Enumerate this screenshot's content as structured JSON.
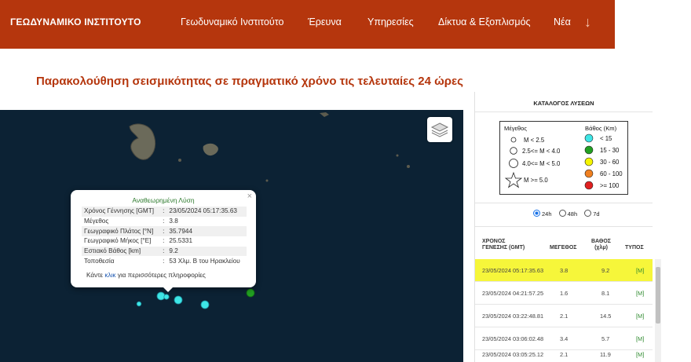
{
  "brand": "ΓΕΩΔΥΝΑΜΙΚΟ ΙΝΣΤΙΤΟΥΤΟ",
  "nav": {
    "items": [
      "Γεωδυναμικό Ινστιτούτο",
      "Έρευνα",
      "Υπηρεσίες",
      "Δίκτυα & Εξοπλισμός",
      "Νέα"
    ],
    "arrow": "↓"
  },
  "page_title": "Παρακολούθηση σεισμικότητας σε πραγματικό χρόνο τις τελευταίες 24 ώρες",
  "popup": {
    "title": "Αναθεωρημένη Λύση",
    "close": "×",
    "rows": [
      {
        "label": "Χρόνος Γέννησης [GMT]",
        "value": "23/05/2024 05:17:35.63"
      },
      {
        "label": "Μέγεθος",
        "value": "3.8"
      },
      {
        "label": "Γεωγραφικό Πλάτος [°N]",
        "value": "35.7944"
      },
      {
        "label": "Γεωγραφικό Μήκος [°E]",
        "value": "25.5331"
      },
      {
        "label": "Εστιακό Βάθος [km]",
        "value": "9.2"
      },
      {
        "label": "Τοποθεσία",
        "value": "53 Χλμ. Β του Ηρακλείου"
      }
    ],
    "more_pre": "Κάντε ",
    "more_link": "κλικ",
    "more_post": " για περισσότερες πληροφορίες"
  },
  "panel": {
    "title": "ΚΑΤΑΛΟΓΟΣ ΛΥΣΕΩΝ",
    "legend": {
      "magnitude_title": "Μέγεθος",
      "magnitude_items": [
        "M < 2.5",
        "2.5<= M < 4.0",
        "4.0<= M < 5.0",
        "M >= 5.0"
      ],
      "depth_title": "Βάθος (Km)",
      "depth_items": [
        {
          "label": "< 15",
          "color": "#3ee6e6"
        },
        {
          "label": "15 - 30",
          "color": "#22a022"
        },
        {
          "label": "30 - 60",
          "color": "#f5f500"
        },
        {
          "label": "60 - 100",
          "color": "#f08020"
        },
        {
          "label": ">= 100",
          "color": "#e02020"
        }
      ]
    },
    "periods": [
      "24h",
      "48h",
      "7d"
    ],
    "selected_period": "24h",
    "columns": {
      "time": "ΧΡΟΝΟΣ\nΓΕΝΕΣΗΣ (GMT)",
      "magnitude": "ΜΕΓΕΘΟΣ",
      "depth": "ΒΑΘΟΣ\n(χλμ)",
      "type": "ΤΥΠΟΣ"
    },
    "rows": [
      {
        "time": "23/05/2024 05:17:35.63",
        "mag": "3.8",
        "depth": "9.2",
        "type": "[M]"
      },
      {
        "time": "23/05/2024 04:21:57.25",
        "mag": "1.6",
        "depth": "8.1",
        "type": "[M]"
      },
      {
        "time": "23/05/2024 03:22:48.81",
        "mag": "2.1",
        "depth": "14.5",
        "type": "[M]"
      },
      {
        "time": "23/05/2024 03:06:02.48",
        "mag": "3.4",
        "depth": "5.7",
        "type": "[M]"
      },
      {
        "time": "23/05/2024 03:05:25.12",
        "mag": "2.1",
        "depth": "11.9",
        "type": "[M]"
      }
    ]
  },
  "map": {
    "sea_color": "#0c2234",
    "land_color": "#6b6a5a",
    "events": [
      {
        "name": "quake-marker-1",
        "size": "medium",
        "depth_class": "< 15"
      },
      {
        "name": "quake-marker-2",
        "size": "small",
        "depth_class": "< 15"
      },
      {
        "name": "quake-marker-3",
        "size": "medium",
        "depth_class": "< 15"
      },
      {
        "name": "quake-marker-4",
        "size": "medium",
        "depth_class": "< 15"
      },
      {
        "name": "quake-marker-5",
        "size": "small",
        "depth_class": "< 15"
      },
      {
        "name": "quake-marker-6",
        "size": "medium",
        "depth_class": "15 - 30"
      }
    ]
  }
}
